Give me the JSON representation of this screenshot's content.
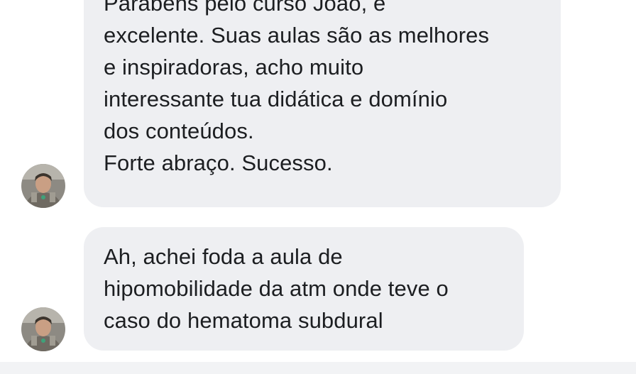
{
  "conversation": {
    "messages": [
      {
        "lines": [
          "Parabéns pelo curso João, é",
          "excelente. Suas aulas são as melhores",
          "e inspiradoras, acho muito",
          "interessante tua didática e domínio",
          "dos conteúdos.",
          "Forte abraço. Sucesso."
        ]
      },
      {
        "lines": [
          "Ah, achei foda a aula de",
          "hipomobilidade da atm onde teve o",
          "caso do hematoma subdural"
        ]
      }
    ]
  },
  "colors": {
    "bubble_background": "#eeeff2",
    "text": "#1c1e21",
    "page_background": "#ffffff",
    "footer_background": "#f2f3f5"
  }
}
